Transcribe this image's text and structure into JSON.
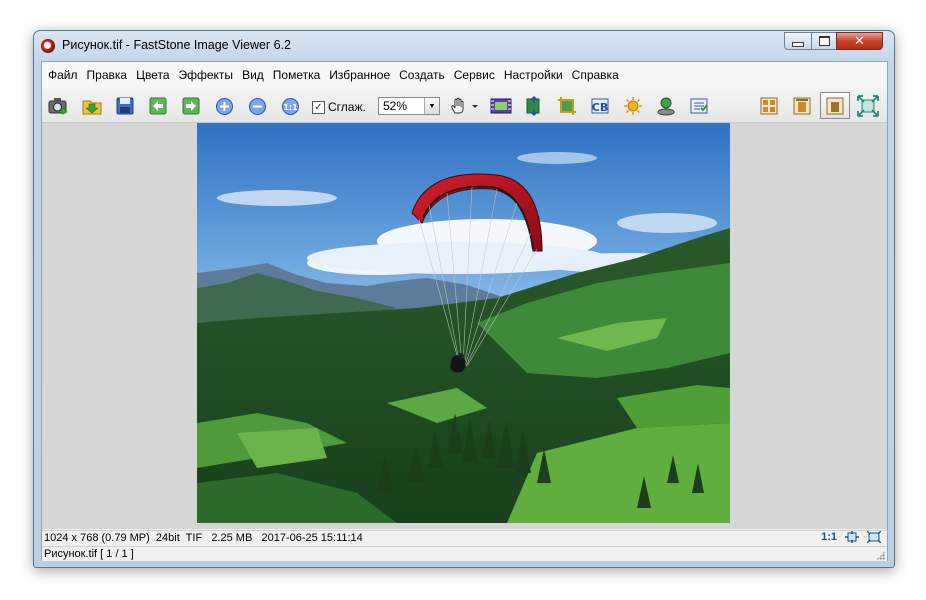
{
  "window": {
    "title": "Рисунок.tif  -  FastStone Image Viewer 6.2",
    "controls": {
      "minimize": "minimize",
      "maximize": "maximize",
      "close": "✕"
    }
  },
  "menu": [
    "Файл",
    "Правка",
    "Цвета",
    "Эффекты",
    "Вид",
    "Пометка",
    "Избранное",
    "Создать",
    "Сервис",
    "Настройки",
    "Справка"
  ],
  "toolbar": {
    "buttons": [
      "open-camera-icon",
      "browse-folder-icon",
      "save-icon",
      "previous-icon",
      "next-icon",
      "zoom-in-icon",
      "zoom-out-icon",
      "actual-size-icon",
      "hand-tool-icon",
      "slideshow-icon",
      "resize-icon",
      "crop-icon",
      "text-icon",
      "effects-icon",
      "print-icon",
      "compare-icon",
      "thumbnails-icon",
      "edit-icon",
      "fullscreen-icon",
      "fit-window-icon"
    ],
    "smooth_label": "Сглаж.",
    "smooth_checked": true,
    "zoom_value": "52%"
  },
  "status": {
    "info": "1024 x 768 (0.79 MP)  24bit  TIF   2.25 MB   2017-06-25 15:11:14",
    "ratio": "1:1",
    "file": "Рисунок.tif [ 1 / 1 ]"
  },
  "colors": {
    "accent": "#16577e",
    "close_button": "#c7432a",
    "viewer_background": "#d6d6d6",
    "canopy": "#d81e2c"
  }
}
